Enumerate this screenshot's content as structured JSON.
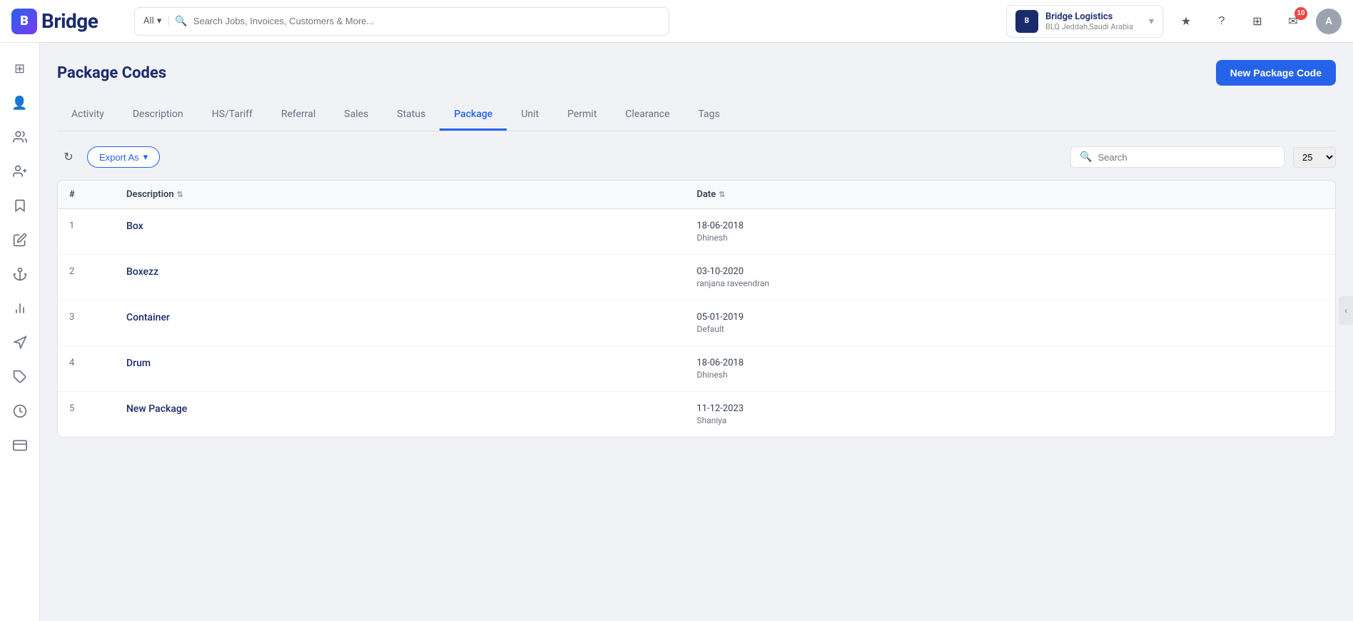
{
  "app": {
    "name": "Bridge"
  },
  "topnav": {
    "search_placeholder": "Search Jobs, Invoices, Customers & More...",
    "search_dropdown_label": "All",
    "company": {
      "name": "Bridge Logistics",
      "sub": "BLQ Jeddah,Saudi Arabia",
      "logo_text": "B"
    },
    "notification_count": "10",
    "avatar_label": "A"
  },
  "sidebar": {
    "icons": [
      {
        "name": "grid-icon",
        "symbol": "⊞"
      },
      {
        "name": "user-icon",
        "symbol": "👤"
      },
      {
        "name": "users-icon",
        "symbol": "👥"
      },
      {
        "name": "user-plus-icon",
        "symbol": "👤+"
      },
      {
        "name": "bookmark-icon",
        "symbol": "🔖"
      },
      {
        "name": "edit-icon",
        "symbol": "✏️"
      },
      {
        "name": "anchor-icon",
        "symbol": "⚓"
      },
      {
        "name": "chart-icon",
        "symbol": "📊"
      },
      {
        "name": "navigation-icon",
        "symbol": "▲"
      },
      {
        "name": "tag-icon",
        "symbol": "🏷"
      },
      {
        "name": "clock-icon",
        "symbol": "🕐"
      },
      {
        "name": "card-icon",
        "symbol": "💳"
      }
    ]
  },
  "page": {
    "title": "Package Codes",
    "new_button_label": "New Package Code"
  },
  "tabs": [
    {
      "label": "Activity",
      "active": false
    },
    {
      "label": "Description",
      "active": false
    },
    {
      "label": "HS/Tariff",
      "active": false
    },
    {
      "label": "Referral",
      "active": false
    },
    {
      "label": "Sales",
      "active": false
    },
    {
      "label": "Status",
      "active": false
    },
    {
      "label": "Package",
      "active": true
    },
    {
      "label": "Unit",
      "active": false
    },
    {
      "label": "Permit",
      "active": false
    },
    {
      "label": "Clearance",
      "active": false
    },
    {
      "label": "Tags",
      "active": false
    }
  ],
  "toolbar": {
    "export_label": "Export As",
    "search_placeholder": "Search",
    "page_size": "25"
  },
  "table": {
    "columns": [
      {
        "label": "#",
        "sortable": false
      },
      {
        "label": "Description",
        "sortable": true
      },
      {
        "label": "Date",
        "sortable": true
      }
    ],
    "rows": [
      {
        "num": "1",
        "description": "Box",
        "date": "18-06-2018",
        "user": "Dhinesh"
      },
      {
        "num": "2",
        "description": "Boxezz",
        "date": "03-10-2020",
        "user": "ranjana raveendran"
      },
      {
        "num": "3",
        "description": "Container",
        "date": "05-01-2019",
        "user": "Default"
      },
      {
        "num": "4",
        "description": "Drum",
        "date": "18-06-2018",
        "user": "Dhinesh"
      },
      {
        "num": "5",
        "description": "New Package",
        "date": "11-12-2023",
        "user": "Shaniya"
      }
    ]
  }
}
